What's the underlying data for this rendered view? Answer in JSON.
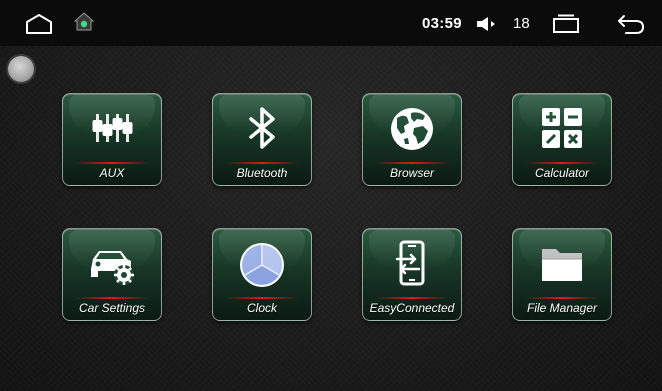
{
  "status_bar": {
    "home_icon": "home-outline-icon",
    "android_home_icon": "android-home-icon",
    "time": "03:59",
    "volume_icon": "speaker-icon",
    "volume_level": "18",
    "recents_icon": "recents-icon",
    "back_icon": "back-arrow-icon"
  },
  "floating_button": {
    "icon": "assistive-dot-icon"
  },
  "apps": [
    {
      "label": "AUX",
      "icon": "equalizer-icon"
    },
    {
      "label": "Bluetooth",
      "icon": "bluetooth-icon"
    },
    {
      "label": "Browser",
      "icon": "globe-icon"
    },
    {
      "label": "Calculator",
      "icon": "calculator-icon"
    },
    {
      "label": "Car Settings",
      "icon": "car-gear-icon"
    },
    {
      "label": "Clock",
      "icon": "clock-icon"
    },
    {
      "label": "EasyConnected",
      "icon": "phone-connect-icon"
    },
    {
      "label": "File Manager",
      "icon": "folder-icon"
    }
  ],
  "colors": {
    "tile_green": "#1f4a33",
    "accent_red": "#e01818",
    "status_bar_bg": "#0b0b0b"
  }
}
